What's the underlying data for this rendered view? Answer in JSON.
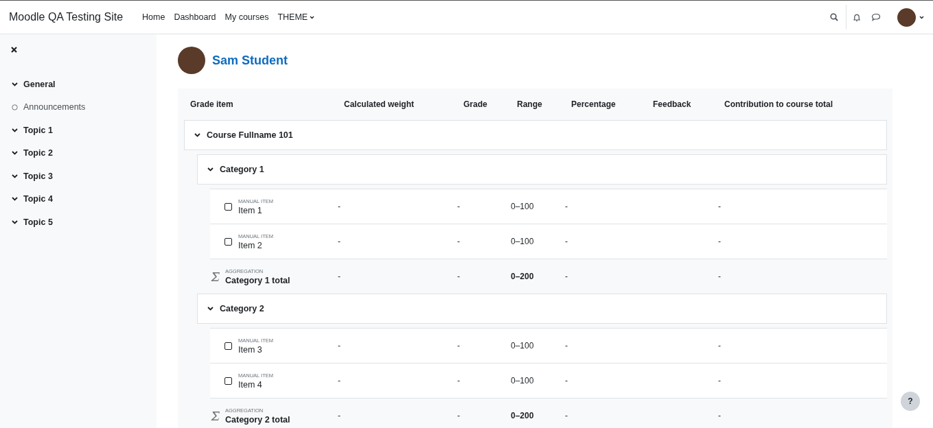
{
  "navbar": {
    "site_name": "Moodle QA Testing Site",
    "links": [
      {
        "label": "Home",
        "dropdown": false
      },
      {
        "label": "Dashboard",
        "dropdown": false
      },
      {
        "label": "My courses",
        "dropdown": false
      },
      {
        "label": "THEME",
        "dropdown": true
      }
    ]
  },
  "sidebar": {
    "items": [
      {
        "label": "General",
        "kind": "section",
        "expanded": true
      },
      {
        "label": "Announcements",
        "kind": "activity"
      },
      {
        "label": "Topic 1",
        "kind": "section",
        "expanded": true
      },
      {
        "label": "Topic 2",
        "kind": "section",
        "expanded": true
      },
      {
        "label": "Topic 3",
        "kind": "section",
        "expanded": true
      },
      {
        "label": "Topic 4",
        "kind": "section",
        "expanded": true
      },
      {
        "label": "Topic 5",
        "kind": "section",
        "expanded": true
      }
    ]
  },
  "user": {
    "name": "Sam Student"
  },
  "table": {
    "columns": [
      "Grade item",
      "Calculated weight",
      "Grade",
      "Range",
      "Percentage",
      "Feedback",
      "Contribution to course total"
    ],
    "course": {
      "name": "Course Fullname 101",
      "expanded": true,
      "categories": [
        {
          "name": "Category 1",
          "expanded": true,
          "rows": [
            {
              "kind": "item",
              "type": "MANUAL ITEM",
              "name": "Item 1",
              "checked": false,
              "weight": "-",
              "grade": "-",
              "range": "0–100",
              "percentage": "-",
              "contribution": "-"
            },
            {
              "kind": "item",
              "type": "MANUAL ITEM",
              "name": "Item 2",
              "checked": false,
              "weight": "-",
              "grade": "-",
              "range": "0–100",
              "percentage": "-",
              "contribution": "-"
            },
            {
              "kind": "total",
              "type": "AGGREGATION",
              "name": "Category 1 total",
              "weight": "-",
              "grade": "-",
              "range": "0–200",
              "percentage": "-",
              "contribution": "-"
            }
          ]
        },
        {
          "name": "Category 2",
          "expanded": true,
          "rows": [
            {
              "kind": "item",
              "type": "MANUAL ITEM",
              "name": "Item 3",
              "checked": false,
              "weight": "-",
              "grade": "-",
              "range": "0–100",
              "percentage": "-",
              "contribution": "-"
            },
            {
              "kind": "item",
              "type": "MANUAL ITEM",
              "name": "Item 4",
              "checked": false,
              "weight": "-",
              "grade": "-",
              "range": "0–100",
              "percentage": "-",
              "contribution": "-"
            },
            {
              "kind": "total",
              "type": "AGGREGATION",
              "name": "Category 2 total",
              "weight": "-",
              "grade": "-",
              "range": "0–200",
              "percentage": "-",
              "contribution": "-"
            }
          ]
        }
      ]
    }
  },
  "help_button": {
    "label": "?"
  }
}
